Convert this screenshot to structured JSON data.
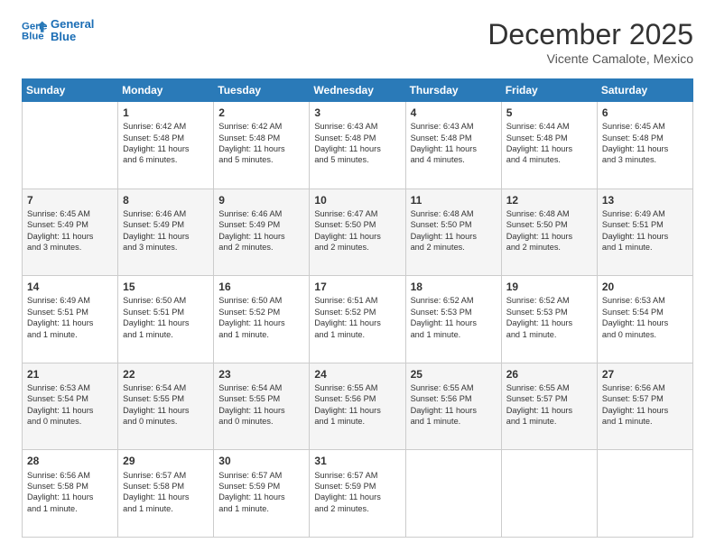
{
  "logo": {
    "line1": "General",
    "line2": "Blue"
  },
  "title": "December 2025",
  "subtitle": "Vicente Camalote, Mexico",
  "header_days": [
    "Sunday",
    "Monday",
    "Tuesday",
    "Wednesday",
    "Thursday",
    "Friday",
    "Saturday"
  ],
  "weeks": [
    [
      {
        "day": "",
        "info": ""
      },
      {
        "day": "1",
        "info": "Sunrise: 6:42 AM\nSunset: 5:48 PM\nDaylight: 11 hours\nand 6 minutes."
      },
      {
        "day": "2",
        "info": "Sunrise: 6:42 AM\nSunset: 5:48 PM\nDaylight: 11 hours\nand 5 minutes."
      },
      {
        "day": "3",
        "info": "Sunrise: 6:43 AM\nSunset: 5:48 PM\nDaylight: 11 hours\nand 5 minutes."
      },
      {
        "day": "4",
        "info": "Sunrise: 6:43 AM\nSunset: 5:48 PM\nDaylight: 11 hours\nand 4 minutes."
      },
      {
        "day": "5",
        "info": "Sunrise: 6:44 AM\nSunset: 5:48 PM\nDaylight: 11 hours\nand 4 minutes."
      },
      {
        "day": "6",
        "info": "Sunrise: 6:45 AM\nSunset: 5:48 PM\nDaylight: 11 hours\nand 3 minutes."
      }
    ],
    [
      {
        "day": "7",
        "info": "Sunrise: 6:45 AM\nSunset: 5:49 PM\nDaylight: 11 hours\nand 3 minutes."
      },
      {
        "day": "8",
        "info": "Sunrise: 6:46 AM\nSunset: 5:49 PM\nDaylight: 11 hours\nand 3 minutes."
      },
      {
        "day": "9",
        "info": "Sunrise: 6:46 AM\nSunset: 5:49 PM\nDaylight: 11 hours\nand 2 minutes."
      },
      {
        "day": "10",
        "info": "Sunrise: 6:47 AM\nSunset: 5:50 PM\nDaylight: 11 hours\nand 2 minutes."
      },
      {
        "day": "11",
        "info": "Sunrise: 6:48 AM\nSunset: 5:50 PM\nDaylight: 11 hours\nand 2 minutes."
      },
      {
        "day": "12",
        "info": "Sunrise: 6:48 AM\nSunset: 5:50 PM\nDaylight: 11 hours\nand 2 minutes."
      },
      {
        "day": "13",
        "info": "Sunrise: 6:49 AM\nSunset: 5:51 PM\nDaylight: 11 hours\nand 1 minute."
      }
    ],
    [
      {
        "day": "14",
        "info": "Sunrise: 6:49 AM\nSunset: 5:51 PM\nDaylight: 11 hours\nand 1 minute."
      },
      {
        "day": "15",
        "info": "Sunrise: 6:50 AM\nSunset: 5:51 PM\nDaylight: 11 hours\nand 1 minute."
      },
      {
        "day": "16",
        "info": "Sunrise: 6:50 AM\nSunset: 5:52 PM\nDaylight: 11 hours\nand 1 minute."
      },
      {
        "day": "17",
        "info": "Sunrise: 6:51 AM\nSunset: 5:52 PM\nDaylight: 11 hours\nand 1 minute."
      },
      {
        "day": "18",
        "info": "Sunrise: 6:52 AM\nSunset: 5:53 PM\nDaylight: 11 hours\nand 1 minute."
      },
      {
        "day": "19",
        "info": "Sunrise: 6:52 AM\nSunset: 5:53 PM\nDaylight: 11 hours\nand 1 minute."
      },
      {
        "day": "20",
        "info": "Sunrise: 6:53 AM\nSunset: 5:54 PM\nDaylight: 11 hours\nand 0 minutes."
      }
    ],
    [
      {
        "day": "21",
        "info": "Sunrise: 6:53 AM\nSunset: 5:54 PM\nDaylight: 11 hours\nand 0 minutes."
      },
      {
        "day": "22",
        "info": "Sunrise: 6:54 AM\nSunset: 5:55 PM\nDaylight: 11 hours\nand 0 minutes."
      },
      {
        "day": "23",
        "info": "Sunrise: 6:54 AM\nSunset: 5:55 PM\nDaylight: 11 hours\nand 0 minutes."
      },
      {
        "day": "24",
        "info": "Sunrise: 6:55 AM\nSunset: 5:56 PM\nDaylight: 11 hours\nand 1 minute."
      },
      {
        "day": "25",
        "info": "Sunrise: 6:55 AM\nSunset: 5:56 PM\nDaylight: 11 hours\nand 1 minute."
      },
      {
        "day": "26",
        "info": "Sunrise: 6:55 AM\nSunset: 5:57 PM\nDaylight: 11 hours\nand 1 minute."
      },
      {
        "day": "27",
        "info": "Sunrise: 6:56 AM\nSunset: 5:57 PM\nDaylight: 11 hours\nand 1 minute."
      }
    ],
    [
      {
        "day": "28",
        "info": "Sunrise: 6:56 AM\nSunset: 5:58 PM\nDaylight: 11 hours\nand 1 minute."
      },
      {
        "day": "29",
        "info": "Sunrise: 6:57 AM\nSunset: 5:58 PM\nDaylight: 11 hours\nand 1 minute."
      },
      {
        "day": "30",
        "info": "Sunrise: 6:57 AM\nSunset: 5:59 PM\nDaylight: 11 hours\nand 1 minute."
      },
      {
        "day": "31",
        "info": "Sunrise: 6:57 AM\nSunset: 5:59 PM\nDaylight: 11 hours\nand 2 minutes."
      },
      {
        "day": "",
        "info": ""
      },
      {
        "day": "",
        "info": ""
      },
      {
        "day": "",
        "info": ""
      }
    ]
  ]
}
